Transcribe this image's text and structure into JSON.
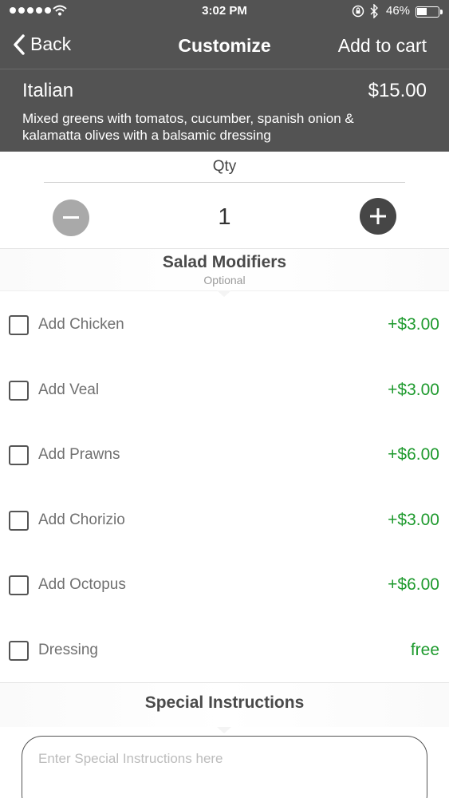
{
  "status_bar": {
    "time": "3:02 PM",
    "battery": "46%",
    "battery_level": 0.46
  },
  "nav": {
    "back_label": "Back",
    "title": "Customize",
    "add_to_cart_label": "Add to cart"
  },
  "item": {
    "name": "Italian",
    "price": "$15.00",
    "description": "Mixed greens with tomatos, cucumber, spanish onion & kalamatta olives with a balsamic dressing"
  },
  "quantity": {
    "label": "Qty",
    "value": "1"
  },
  "modifiers": {
    "title": "Salad Modifiers",
    "subtitle": "Optional",
    "items": [
      {
        "label": "Add Chicken",
        "price": "+$3.00",
        "checked": false
      },
      {
        "label": "Add Veal",
        "price": "+$3.00",
        "checked": false
      },
      {
        "label": "Add Prawns",
        "price": "+$6.00",
        "checked": false
      },
      {
        "label": "Add Chorizio",
        "price": "+$3.00",
        "checked": false
      },
      {
        "label": "Add Octopus",
        "price": "+$6.00",
        "checked": false
      },
      {
        "label": "Dressing",
        "price": "free",
        "checked": false
      }
    ]
  },
  "special_instructions": {
    "title": "Special Instructions",
    "placeholder": "Enter Special Instructions here"
  },
  "colors": {
    "header_bg": "#535353",
    "price_green": "#1e9a2e",
    "minus_button": "#a9a9a9",
    "plus_button": "#464646"
  },
  "icons": [
    "signal-dots-icon",
    "wifi-icon",
    "rotation-lock-icon",
    "bluetooth-icon",
    "battery-icon",
    "chevron-left-icon",
    "minus-icon",
    "plus-icon",
    "checkbox-icon"
  ]
}
